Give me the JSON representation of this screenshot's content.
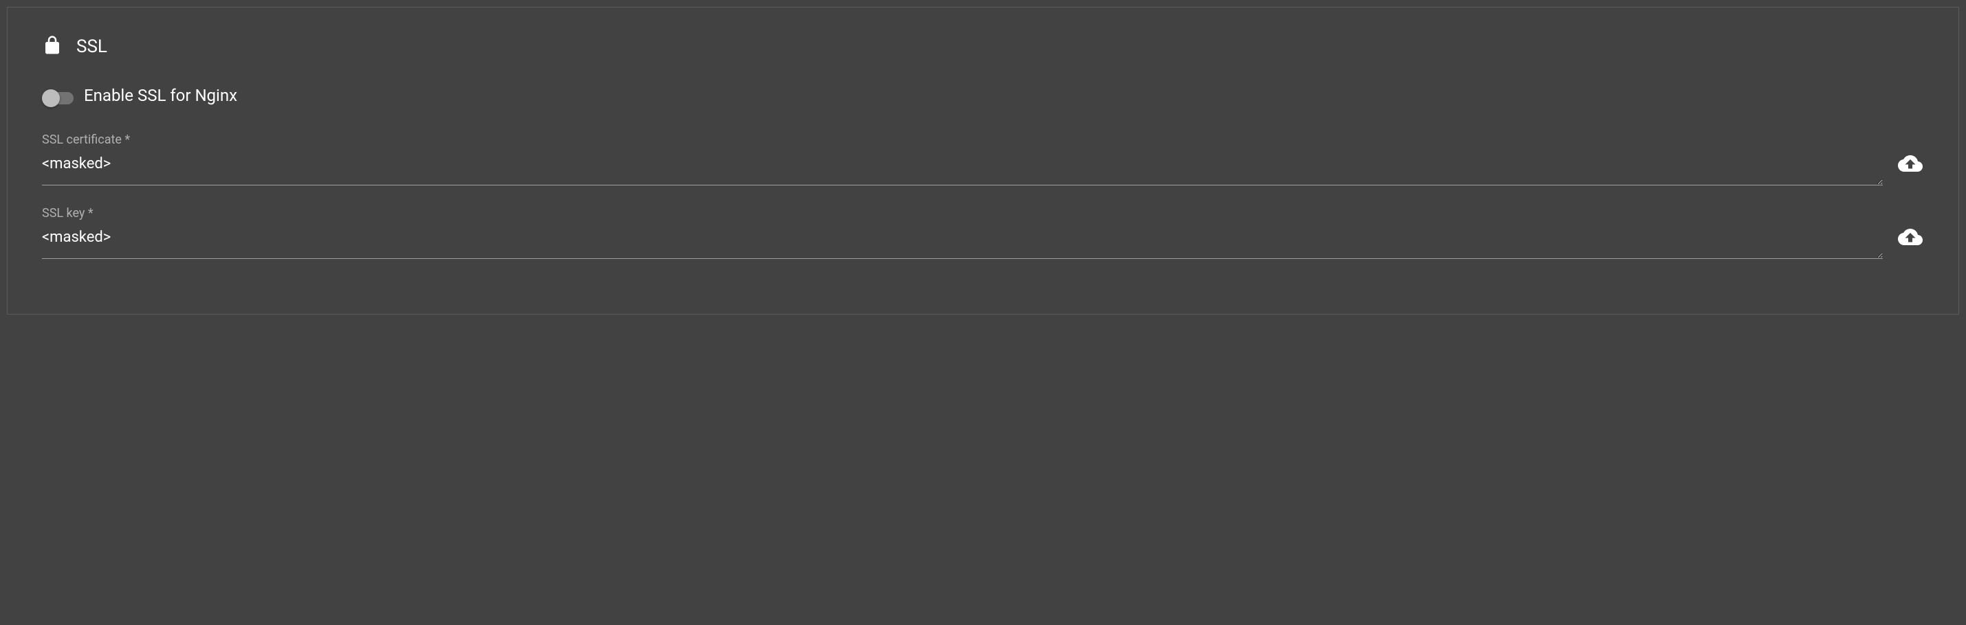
{
  "section": {
    "title": "SSL"
  },
  "toggle": {
    "label": "Enable SSL for Nginx",
    "enabled": false
  },
  "fields": {
    "certificate": {
      "label": "SSL certificate *",
      "value": "<masked>"
    },
    "key": {
      "label": "SSL key *",
      "value": "<masked>"
    }
  }
}
